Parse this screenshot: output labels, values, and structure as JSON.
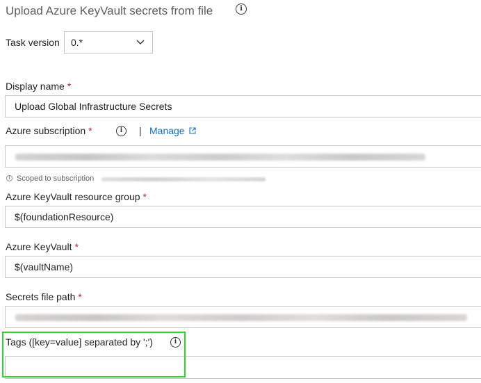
{
  "header": {
    "title": "Upload Azure KeyVault secrets from file",
    "icon": "info-icon"
  },
  "task_version": {
    "label": "Task version",
    "value": "0.*",
    "icon": "chevron-down-icon"
  },
  "display_name": {
    "label": "Display name",
    "required": "*",
    "value": "Upload Global Infrastructure Secrets"
  },
  "azure_subscription": {
    "label": "Azure subscription",
    "required": "*",
    "separator": "|",
    "manage_label": "Manage",
    "value": "",
    "scope_note": "Scoped to subscription"
  },
  "resource_group": {
    "label": "Azure KeyVault resource group",
    "required": "*",
    "value": "$(foundationResource)"
  },
  "keyvault": {
    "label": "Azure KeyVault",
    "required": "*",
    "value": "$(vaultName)"
  },
  "secrets_file": {
    "label": "Secrets file path",
    "required": "*",
    "value": ""
  },
  "tags": {
    "label": "Tags ([key=value] separated by ';')",
    "value": ""
  },
  "colors": {
    "required": "#a4262c",
    "link": "#106ebe",
    "highlight": "#2fd42f",
    "border": "#c8c6c4"
  }
}
